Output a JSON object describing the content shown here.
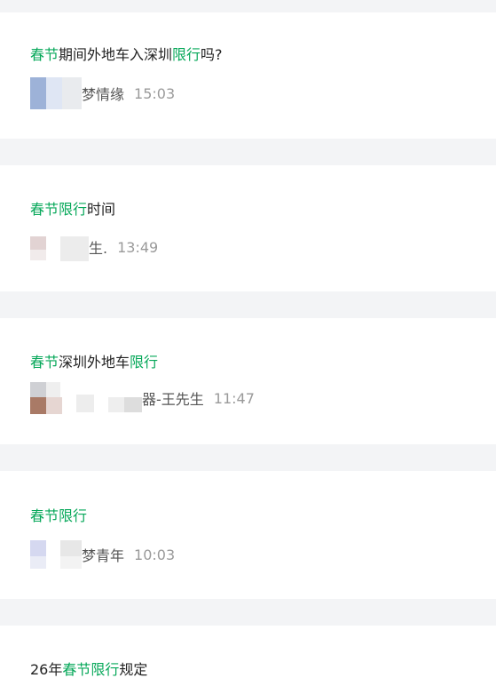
{
  "posts": [
    {
      "title": [
        {
          "text": "春节",
          "hl": true
        },
        {
          "text": "期间外地车入深圳",
          "hl": false
        },
        {
          "text": "限行",
          "hl": true
        },
        {
          "text": "吗?",
          "hl": false
        }
      ],
      "author": "梦情缘",
      "time": "15:03"
    },
    {
      "title": [
        {
          "text": "春节限行",
          "hl": true
        },
        {
          "text": "时间",
          "hl": false
        }
      ],
      "author": "生.",
      "time": "13:49"
    },
    {
      "title": [
        {
          "text": "春节",
          "hl": true
        },
        {
          "text": "深圳外地车",
          "hl": false
        },
        {
          "text": "限行",
          "hl": true
        }
      ],
      "author": "器-王先生",
      "time": "11:47"
    },
    {
      "title": [
        {
          "text": "春节限行",
          "hl": true
        }
      ],
      "author": "梦青年",
      "time": "10:03"
    },
    {
      "title": [
        {
          "text": "26年",
          "hl": false
        },
        {
          "text": "春节限行",
          "hl": true
        },
        {
          "text": "规定",
          "hl": false
        }
      ],
      "author": "",
      "time": ""
    }
  ],
  "colors": {
    "highlight": "#07a85a",
    "title_text": "#222222",
    "meta_time": "#9a9a9a",
    "page_bg": "#f3f4f6",
    "card_bg": "#ffffff"
  }
}
